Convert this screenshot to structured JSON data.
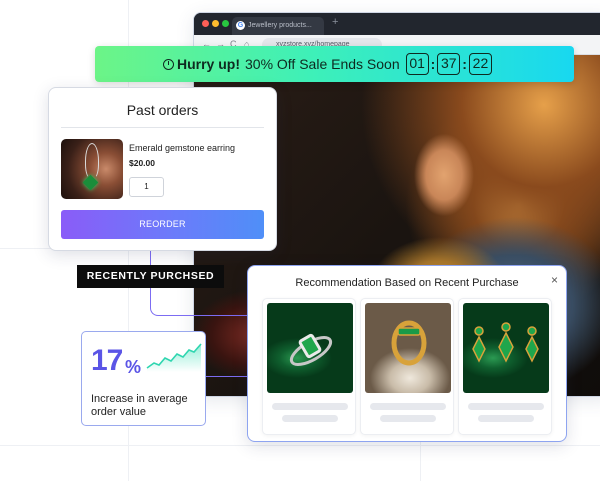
{
  "browser": {
    "tab_title": "Jewellery products...",
    "tab_favicon": "G",
    "new_tab": "+",
    "url": "xyzstore.xyz/homepage",
    "nav": {
      "back": "←",
      "forward": "→",
      "reload": "C",
      "home": "⌂"
    }
  },
  "sale_banner": {
    "lead": "Hurry up!",
    "text": "30% Off Sale Ends Soon",
    "hours": "01",
    "minutes": "37",
    "seconds": "22",
    "sep": ":"
  },
  "past_orders": {
    "title": "Past orders",
    "product_name": "Emerald gemstone earring",
    "price": "$20.00",
    "quantity": "1",
    "reorder_label": "REORDER"
  },
  "tag": {
    "label": "RECENTLY PURCHSED"
  },
  "stat": {
    "value": "17",
    "unit": "%",
    "label": "Increase in average order value"
  },
  "recommendation": {
    "title": "Recommendation Based on Recent Purchase",
    "close": "×"
  },
  "colors": {
    "accent": "#5b55e6",
    "button_gradient_start": "#8a5cf8",
    "button_gradient_end": "#4f8ff8",
    "banner_gradient_start": "#6cf487",
    "banner_gradient_end": "#18d8f0",
    "tag_bg": "#0c0c0c"
  },
  "icons": [
    "clock-icon",
    "close-icon",
    "sparkline-icon",
    "google-favicon-icon"
  ]
}
